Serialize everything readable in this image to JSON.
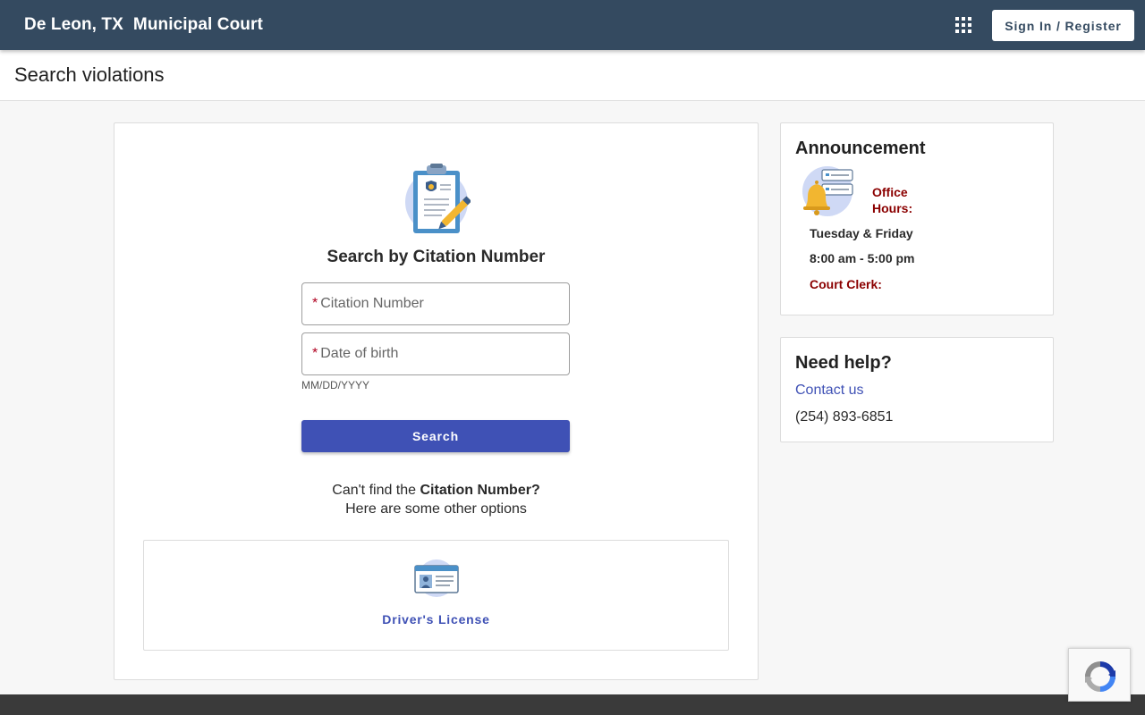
{
  "header": {
    "city": "De Leon, TX",
    "court": "Municipal Court",
    "apps_icon": "apps-grid-icon",
    "signin_label": "Sign In / Register"
  },
  "page": {
    "title": "Search violations"
  },
  "search": {
    "icon": "clipboard-badge-icon",
    "title": "Search by Citation Number",
    "citation_placeholder": "Citation Number",
    "dob_placeholder": "Date of birth",
    "required_mark": "*",
    "dob_hint": "MM/DD/YYYY",
    "button_label": "Search",
    "cant_find_prefix": "Can't find the ",
    "cant_find_bold": "Citation Number?",
    "other_options": "Here are some other options",
    "options": [
      {
        "label": "Driver's License",
        "icon": "drivers-license-icon"
      }
    ]
  },
  "announcement": {
    "title": "Announcement",
    "icon": "bell-announcement-icon",
    "office_hours_label": "Office Hours:",
    "days": "Tuesday & Friday",
    "hours": "8:00 am - 5:00 pm",
    "clerk_label": "Court Clerk:"
  },
  "help": {
    "title": "Need help?",
    "contact_label": "Contact us",
    "phone": "(254) 893-6851"
  },
  "colors": {
    "topbar": "#344a60",
    "primary": "#3f51b5",
    "announcement_red": "#8b0000",
    "footer": "#3a3a3a"
  },
  "recaptcha": {
    "icon": "recaptcha-icon"
  }
}
